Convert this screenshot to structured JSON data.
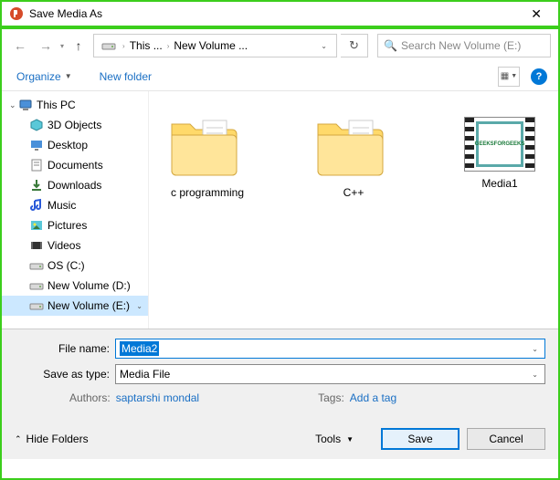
{
  "window": {
    "title": "Save Media As"
  },
  "nav": {
    "crumbs": [
      "This ...",
      "New Volume ..."
    ],
    "search_placeholder": "Search New Volume (E:)"
  },
  "toolbar": {
    "organize": "Organize",
    "newfolder": "New folder"
  },
  "sidebar": {
    "top": "This PC",
    "items": [
      {
        "label": "3D Objects",
        "icon": "cube"
      },
      {
        "label": "Desktop",
        "icon": "desktop"
      },
      {
        "label": "Documents",
        "icon": "doc"
      },
      {
        "label": "Downloads",
        "icon": "down"
      },
      {
        "label": "Music",
        "icon": "music"
      },
      {
        "label": "Pictures",
        "icon": "pic"
      },
      {
        "label": "Videos",
        "icon": "video"
      },
      {
        "label": "OS (C:)",
        "icon": "drive"
      },
      {
        "label": "New Volume (D:)",
        "icon": "drive"
      },
      {
        "label": "New Volume (E:)",
        "icon": "drive",
        "selected": true
      }
    ]
  },
  "files": [
    {
      "name": "c programming",
      "type": "folder"
    },
    {
      "name": "C++",
      "type": "folder"
    },
    {
      "name": "Media1",
      "type": "media",
      "thumb_text": "GEEKSFORGEEKS"
    }
  ],
  "form": {
    "filename_label": "File name:",
    "filename_value": "Media2",
    "saveastype_label": "Save as type:",
    "saveastype_value": "Media File",
    "authors_label": "Authors:",
    "authors_value": "saptarshi mondal",
    "tags_label": "Tags:",
    "tags_value": "Add a tag"
  },
  "buttons": {
    "hidefolders": "Hide Folders",
    "tools": "Tools",
    "save": "Save",
    "cancel": "Cancel"
  }
}
